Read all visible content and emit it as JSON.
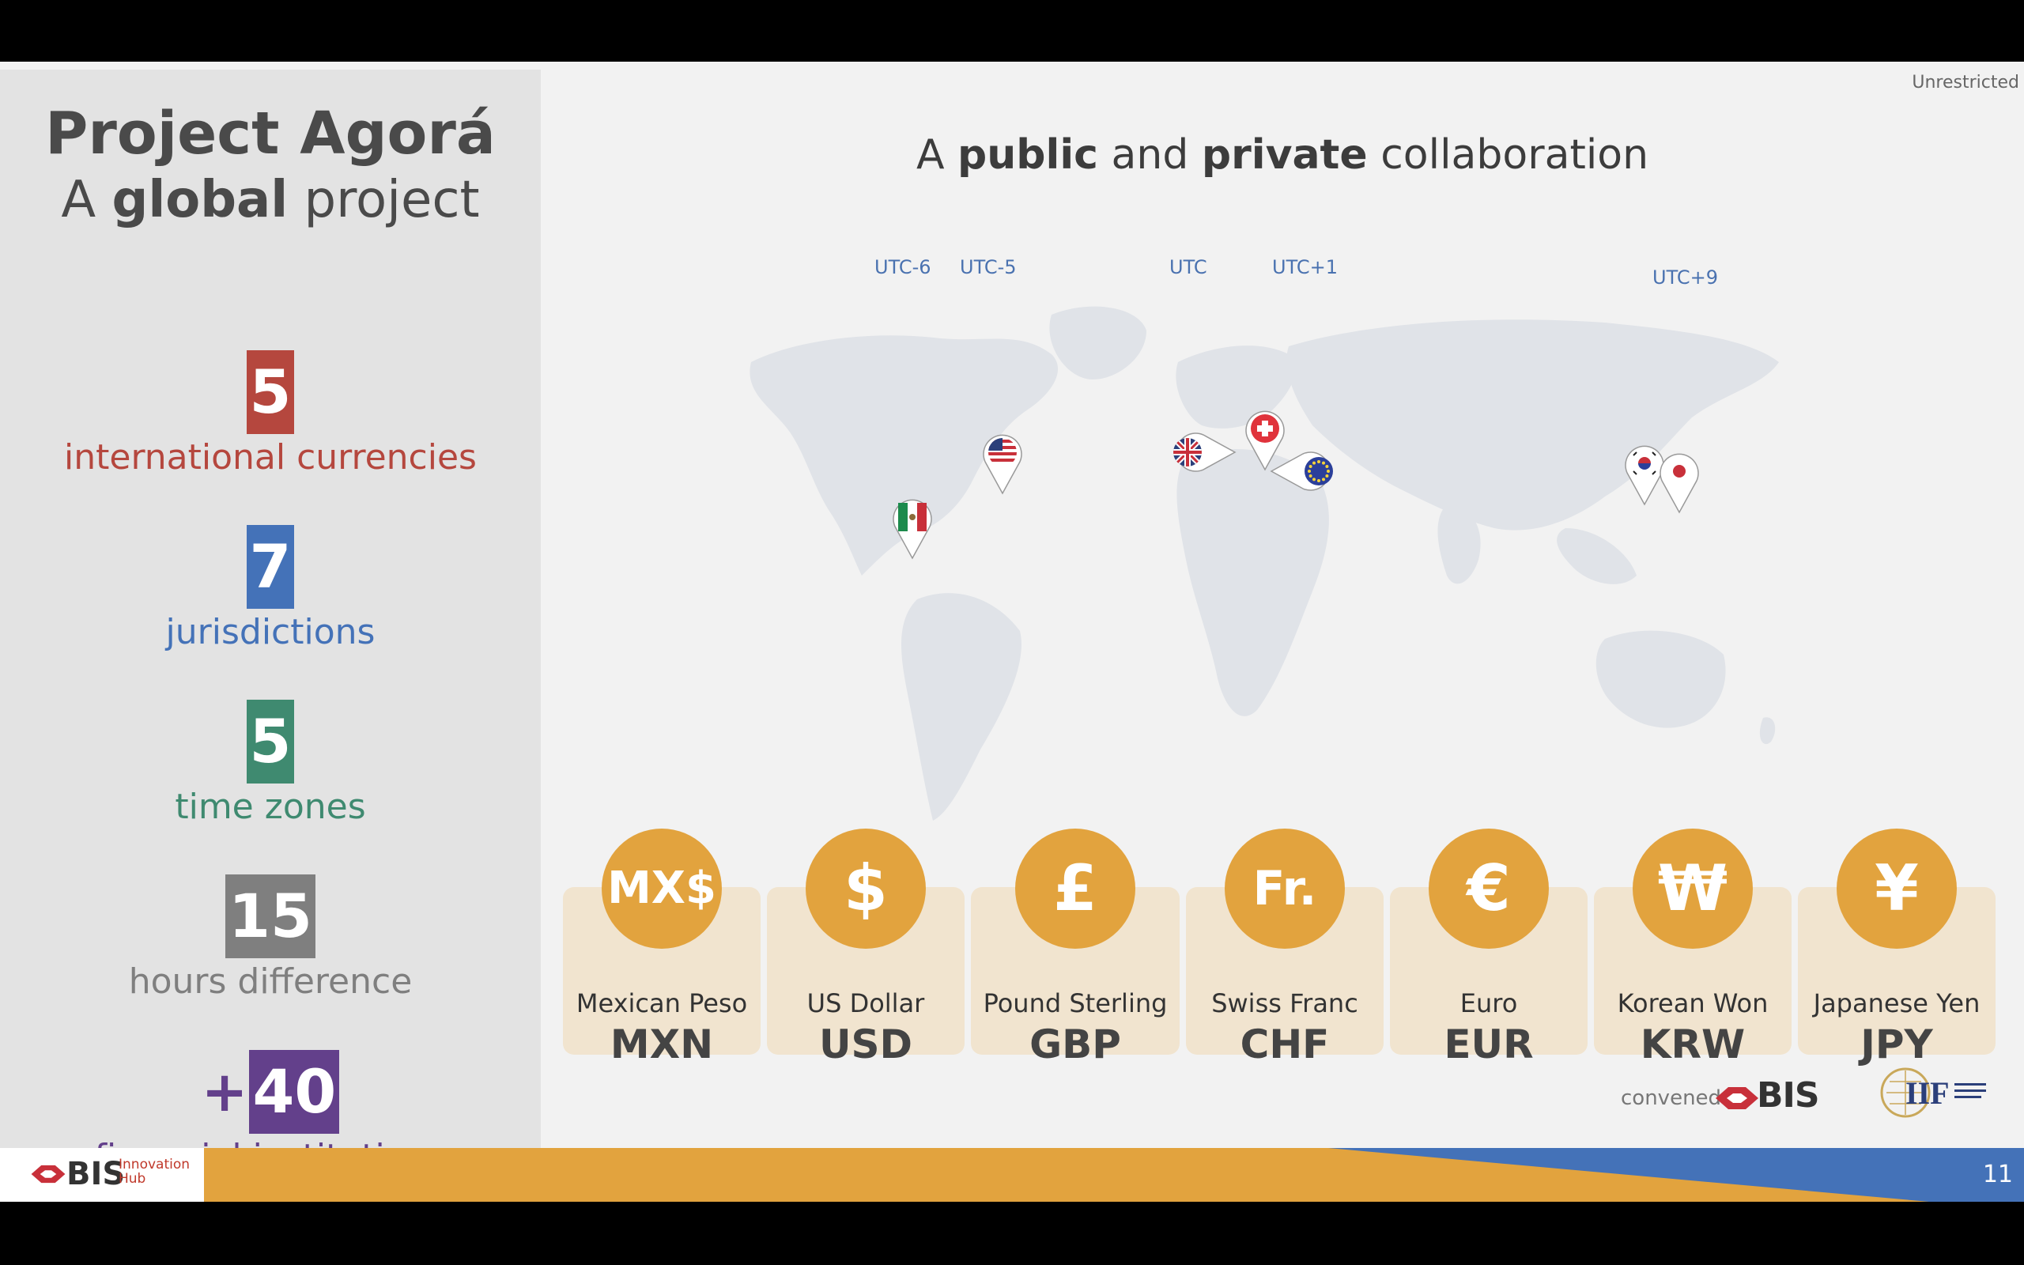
{
  "left_panel": {
    "title": "Project Agorá",
    "subtitle_pre": "A ",
    "subtitle_bold": "global",
    "subtitle_post": " project",
    "stats": [
      {
        "value": "5",
        "label": "international currencies",
        "color": "#b5473e"
      },
      {
        "value": "7",
        "label": "jurisdictions",
        "color": "#4472b8"
      },
      {
        "value": "5",
        "label": "time zones",
        "color": "#3f8a70"
      },
      {
        "value": "15",
        "label": "hours difference",
        "color": "#7f7f7f"
      },
      {
        "prefix": "+",
        "value": "40",
        "label": "financial institutions",
        "color": "#63408b"
      }
    ]
  },
  "classification": "Unrestricted",
  "main_title": {
    "pre": "A ",
    "bold1": "public",
    "mid": " and ",
    "bold2": "private",
    "post": " collaboration"
  },
  "timezones": [
    "UTC-6",
    "UTC-5",
    "UTC",
    "UTC+1",
    "UTC+9"
  ],
  "pins": [
    {
      "name": "mexico-flag-pin"
    },
    {
      "name": "usa-flag-pin"
    },
    {
      "name": "uk-flag-pin"
    },
    {
      "name": "switzerland-flag-pin"
    },
    {
      "name": "eu-flag-pin"
    },
    {
      "name": "korea-flag-pin"
    },
    {
      "name": "japan-flag-pin"
    }
  ],
  "currencies": [
    {
      "symbol": "MX$",
      "name": "Mexican Peso",
      "code": "MXN"
    },
    {
      "symbol": "$",
      "name": "US Dollar",
      "code": "USD"
    },
    {
      "symbol": "£",
      "name": "Pound Sterling",
      "code": "GBP"
    },
    {
      "symbol": "Fr.",
      "name": "Swiss Franc",
      "code": "CHF"
    },
    {
      "symbol": "€",
      "name": "Euro",
      "code": "EUR"
    },
    {
      "symbol": "₩",
      "name": "Korean Won",
      "code": "KRW"
    },
    {
      "symbol": "¥",
      "name": "Japanese Yen",
      "code": "JPY"
    }
  ],
  "convened_by": "convened by",
  "bis_logo_text": "BIS",
  "iif_logo_text": "IIF",
  "footer": {
    "logo_text": "BIS",
    "logo_sub1": "Innovation",
    "logo_sub2": "Hub",
    "page_number": "11"
  },
  "colors": {
    "accent_orange": "#e2a33e",
    "card_bg": "#f1e4cf",
    "footer_blue": "#4472b8",
    "utc_blue": "#4a72b0"
  }
}
